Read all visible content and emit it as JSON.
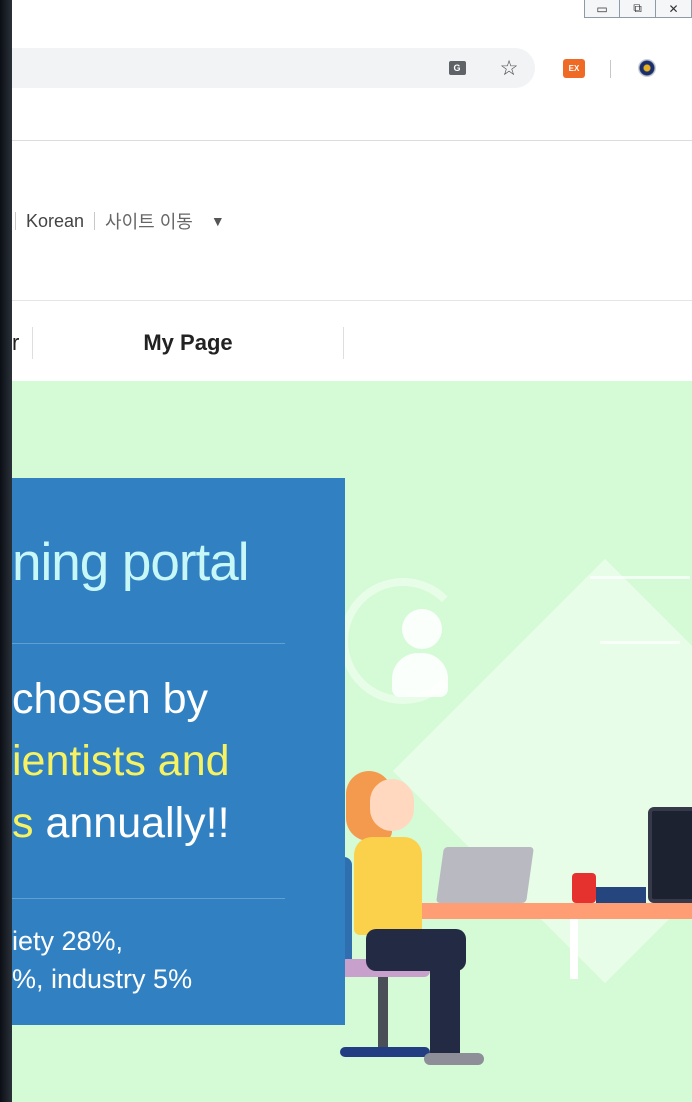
{
  "window": {
    "controls": [
      "▭",
      "⧉",
      "✕"
    ]
  },
  "toolbar": {
    "icons": [
      "translate-icon",
      "star-icon",
      "extension-icon",
      "profile-icon"
    ],
    "extension_label": "EX",
    "translate_label": "G"
  },
  "header": {
    "lang_current": "Korean",
    "site_move": "사이트 이동",
    "caret": "▼"
  },
  "nav": {
    "cut_item": "r",
    "my_page": "My Page"
  },
  "hero": {
    "title": "ning portal",
    "line1": "chosen by",
    "line2": "ientists and",
    "line3_highlight": "s",
    "line3_rest": " annually!!",
    "stats_line1": "iety 28%,",
    "stats_line2": "%, industry 5%"
  },
  "colors": {
    "hero_bg": "#d4fbd6",
    "panel_blue": "#3181c2",
    "highlight_yellow": "#f6f262",
    "title_cyan": "#c7f7f7"
  }
}
